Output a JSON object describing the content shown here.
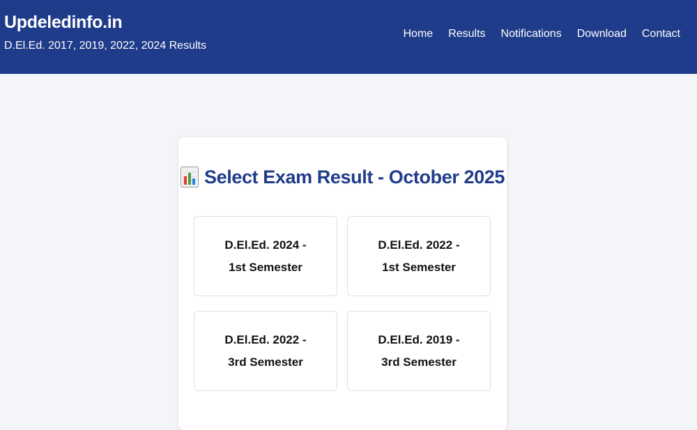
{
  "header": {
    "site_title": "Updeledinfo.in",
    "subtitle": "D.El.Ed. 2017, 2019, 2022, 2024 Results",
    "background_color": "#1f3c8a",
    "nav": [
      {
        "label": "Home"
      },
      {
        "label": "Results"
      },
      {
        "label": "Notifications"
      },
      {
        "label": "Download"
      },
      {
        "label": "Contact"
      }
    ]
  },
  "main": {
    "heading_icon": "bar-chart-icon",
    "heading": "Select Exam Result - October 2025",
    "heading_color": "#1f3c8a",
    "options": [
      {
        "label": "D.El.Ed. 2024 - 1st Semester"
      },
      {
        "label": "D.El.Ed. 2022 - 1st Semester"
      },
      {
        "label": "D.El.Ed. 2022 - 3rd Semester"
      },
      {
        "label": "D.El.Ed. 2019 - 3rd Semester"
      }
    ]
  }
}
